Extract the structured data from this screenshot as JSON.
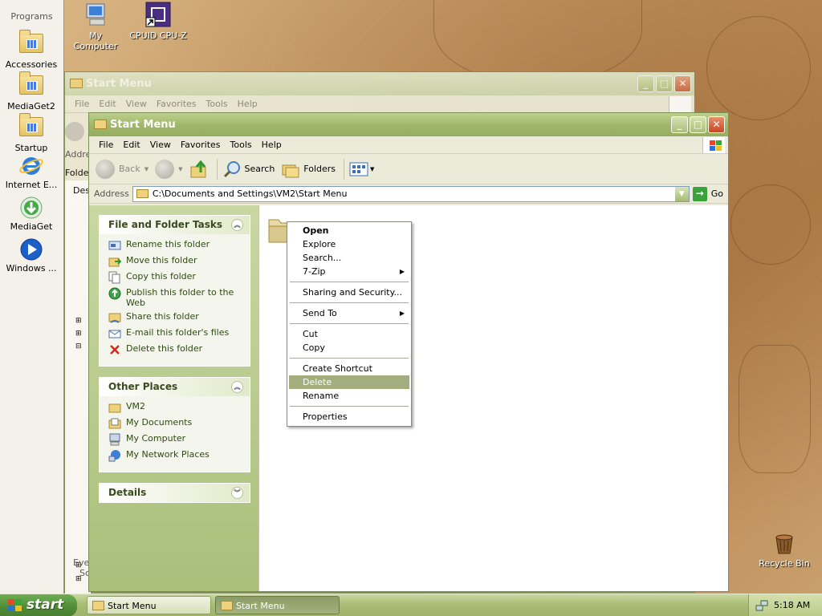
{
  "programs_bar": {
    "title": "Programs",
    "items": [
      {
        "label": "Accessories",
        "icon": "program-group-icon"
      },
      {
        "label": "MediaGet2",
        "icon": "program-group-icon"
      },
      {
        "label": "Startup",
        "icon": "program-group-icon"
      },
      {
        "label": "Internet E...",
        "icon": "internet-explorer-icon"
      },
      {
        "label": "MediaGet",
        "icon": "mediaget-icon"
      },
      {
        "label": "Windows ...",
        "icon": "media-player-icon"
      }
    ]
  },
  "desktop": {
    "icons": [
      {
        "label": "My Computer",
        "icon": "my-computer-icon"
      },
      {
        "label": "CPUID CPU-Z",
        "icon": "cpu-z-icon"
      },
      {
        "label": "Recycle Bin",
        "icon": "recycle-bin-icon"
      }
    ]
  },
  "back_window": {
    "title": "Start Menu",
    "menu": [
      "File",
      "Edit",
      "View",
      "Favorites",
      "Tools",
      "Help"
    ],
    "partial_labels": {
      "back": "B",
      "address": "Addres",
      "folders": "Folders",
      "tree_desktop": "Des",
      "status": "Eve",
      "status2": "Sc"
    }
  },
  "front_window": {
    "title": "Start Menu",
    "menu": [
      "File",
      "Edit",
      "View",
      "Favorites",
      "Tools",
      "Help"
    ],
    "toolbar": {
      "back": "Back",
      "search": "Search",
      "folders": "Folders"
    },
    "address": {
      "label": "Address",
      "value": "C:\\Documents and Settings\\VM2\\Start Menu",
      "go": "Go"
    },
    "taskpane": {
      "file_folder_tasks": {
        "title": "File and Folder Tasks",
        "items": [
          {
            "label": "Rename this folder",
            "icon": "rename-icon"
          },
          {
            "label": "Move this folder",
            "icon": "move-icon"
          },
          {
            "label": "Copy this folder",
            "icon": "copy-icon"
          },
          {
            "label": "Publish this folder to the Web",
            "icon": "publish-web-icon"
          },
          {
            "label": "Share this folder",
            "icon": "share-icon"
          },
          {
            "label": "E-mail this folder's files",
            "icon": "email-icon"
          },
          {
            "label": "Delete this folder",
            "icon": "delete-icon"
          }
        ]
      },
      "other_places": {
        "title": "Other Places",
        "items": [
          {
            "label": "VM2",
            "icon": "folder-icon"
          },
          {
            "label": "My Documents",
            "icon": "my-documents-icon"
          },
          {
            "label": "My Computer",
            "icon": "my-computer-icon"
          },
          {
            "label": "My Network Places",
            "icon": "network-places-icon"
          }
        ]
      },
      "details": {
        "title": "Details"
      }
    }
  },
  "context_menu": {
    "items": [
      {
        "label": "Open",
        "bold": true
      },
      {
        "label": "Explore"
      },
      {
        "label": "Search..."
      },
      {
        "label": "7-Zip",
        "submenu": true
      },
      {
        "separator": true
      },
      {
        "label": "Sharing and Security..."
      },
      {
        "separator": true
      },
      {
        "label": "Send To",
        "submenu": true
      },
      {
        "separator": true
      },
      {
        "label": "Cut"
      },
      {
        "label": "Copy"
      },
      {
        "separator": true
      },
      {
        "label": "Create Shortcut"
      },
      {
        "label": "Delete",
        "highlighted": true
      },
      {
        "label": "Rename"
      },
      {
        "separator": true
      },
      {
        "label": "Properties"
      }
    ]
  },
  "taskbar": {
    "start": "start",
    "buttons": [
      {
        "label": "Start Menu",
        "active": false
      },
      {
        "label": "Start Menu",
        "active": true
      }
    ],
    "clock": "5:18 AM"
  },
  "colors": {
    "accent": "#a1b86b",
    "highlight": "#a3ad7e",
    "link": "#2f4a12"
  }
}
